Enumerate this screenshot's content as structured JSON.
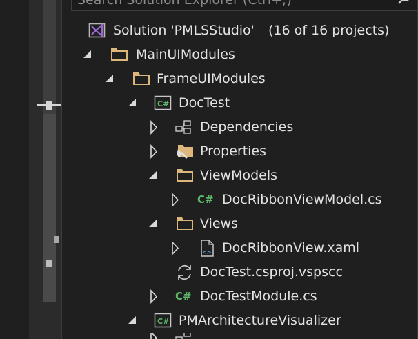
{
  "search": {
    "placeholder": "Search Solution Explorer (Ctrl+;)"
  },
  "tree": {
    "solution": {
      "label": "Solution 'PMLSStudio'",
      "count": "(16 of 16 projects)"
    },
    "items": [
      {
        "label": "MainUIModules",
        "icon": "folder-icon",
        "expander": "expanded"
      },
      {
        "label": "FrameUIModules",
        "icon": "folder-icon",
        "expander": "expanded"
      },
      {
        "label": "DocTest",
        "icon": "csharp-project-icon",
        "expander": "expanded"
      },
      {
        "label": "Dependencies",
        "icon": "dependencies-icon",
        "expander": "collapsed"
      },
      {
        "label": "Properties",
        "icon": "properties-icon",
        "expander": "collapsed"
      },
      {
        "label": "ViewModels",
        "icon": "folder-icon",
        "expander": "expanded"
      },
      {
        "label": "DocRibbonViewModel.cs",
        "icon": "csharp-file-icon",
        "expander": "collapsed"
      },
      {
        "label": "Views",
        "icon": "folder-icon",
        "expander": "expanded"
      },
      {
        "label": "DocRibbonView.xaml",
        "icon": "xaml-file-icon",
        "expander": "collapsed"
      },
      {
        "label": "DocTest.csproj.vspscc",
        "icon": "sync-file-icon",
        "expander": "none"
      },
      {
        "label": "DocTestModule.cs",
        "icon": "csharp-file-icon",
        "expander": "collapsed"
      },
      {
        "label": "PMArchitectureVisualizer",
        "icon": "csharp-project-icon",
        "expander": "expanded"
      }
    ]
  },
  "colors": {
    "background": "#1f1f1f",
    "folder": "#dcb67a",
    "csharp": "#5fb96a",
    "vs_purple": "#9b6bd3"
  }
}
